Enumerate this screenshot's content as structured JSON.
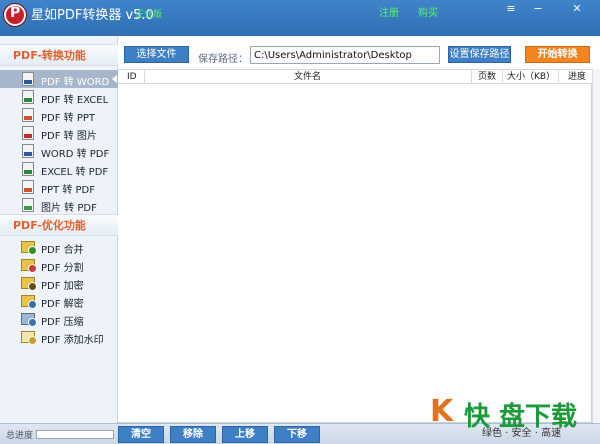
{
  "window": {
    "title": "星如PDF转换器 v5.0",
    "tag": "正式版",
    "links": [
      "注册",
      "购买"
    ],
    "controls": {
      "menu": "≡",
      "minimize": "−",
      "close": "✕"
    }
  },
  "sidebar": {
    "convert_header": "PDF-转换功能",
    "convert_items": [
      {
        "label": "PDF 转 WORD",
        "icon": "word-file-icon",
        "active": true
      },
      {
        "label": "PDF 转 EXCEL",
        "icon": "excel-file-icon"
      },
      {
        "label": "PDF 转 PPT",
        "icon": "ppt-file-icon"
      },
      {
        "label": "PDF 转 图片",
        "icon": "image-file-icon"
      },
      {
        "label": "WORD 转 PDF",
        "icon": "word-file-icon"
      },
      {
        "label": "EXCEL 转 PDF",
        "icon": "excel-file-icon"
      },
      {
        "label": "PPT 转 PDF",
        "icon": "ppt-file-icon"
      },
      {
        "label": "图片 转 PDF",
        "icon": "image-file-icon"
      }
    ],
    "optimize_header": "PDF-优化功能",
    "optimize_items": [
      {
        "label": "PDF 合并",
        "icon": "folder-merge-icon"
      },
      {
        "label": "PDF 分割",
        "icon": "folder-split-icon"
      },
      {
        "label": "PDF 加密",
        "icon": "lock-icon"
      },
      {
        "label": "PDF 解密",
        "icon": "unlock-icon"
      },
      {
        "label": "PDF 压缩",
        "icon": "compress-icon"
      },
      {
        "label": "PDF 添加水印",
        "icon": "watermark-icon"
      }
    ]
  },
  "toolbar": {
    "select_file": "选择文件",
    "save_path_label": "保存路径：",
    "save_path_value": "C:\\Users\\Administrator\\Desktop",
    "set_save_path": "设置保存路径",
    "start": "开始转换"
  },
  "table": {
    "columns": [
      "ID",
      "文件名",
      "页数",
      "大小（KB）",
      "进度"
    ]
  },
  "bottom": {
    "progress_label": "总进度",
    "progress_value": 0,
    "buttons": [
      "清空",
      "移除",
      "上移",
      "下移"
    ]
  },
  "watermark": {
    "k": "K",
    "big": "快 盘下载",
    "small": "绿色 · 安全 · 高速"
  },
  "colors": {
    "accent": "#3f7fc6",
    "start": "#f38420",
    "header_text": "#e2612b"
  }
}
